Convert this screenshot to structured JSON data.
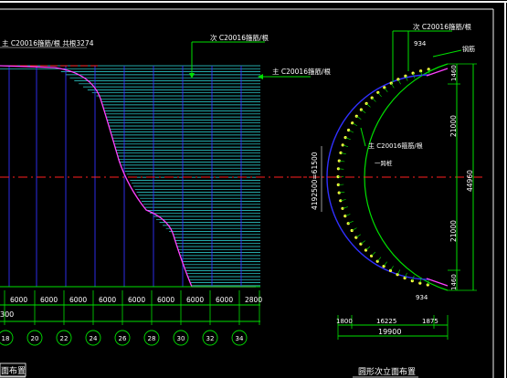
{
  "left_elevation": {
    "top_label": "主 C20016箍筋/根  共根3274",
    "callout_top": "次 C20016箍筋/根",
    "callout_right": "主 C20016箍筋/根",
    "dimensions": [
      "6000",
      "6000",
      "6000",
      "6000",
      "6000",
      "6000",
      "6000",
      "6000",
      "2800"
    ],
    "left_partial_dim": "300",
    "axis_labels": [
      "18",
      "20",
      "22",
      "24",
      "26",
      "28",
      "30",
      "32",
      "34"
    ],
    "bottom_title": "面布置"
  },
  "section": {
    "callout_top": "次 C20016箍筋/根",
    "callout_reinforcement": "钢筋",
    "dim_934_top": "934",
    "dim_934_bottom": "934",
    "dim_1460_top": "1460",
    "dim_21000_top": "21000",
    "dim_44960": "44960",
    "dim_21000_bottom": "21000",
    "dim_1460_bottom": "1460",
    "radius_label": "4192500=61500",
    "inner_callout": "主 C20016箍筋/根",
    "inner_callout_2": "一跨桩",
    "bottom_dims": [
      "1800",
      "16225",
      "1875"
    ],
    "bottom_total": "19900",
    "title": "圆形次立面布置"
  }
}
